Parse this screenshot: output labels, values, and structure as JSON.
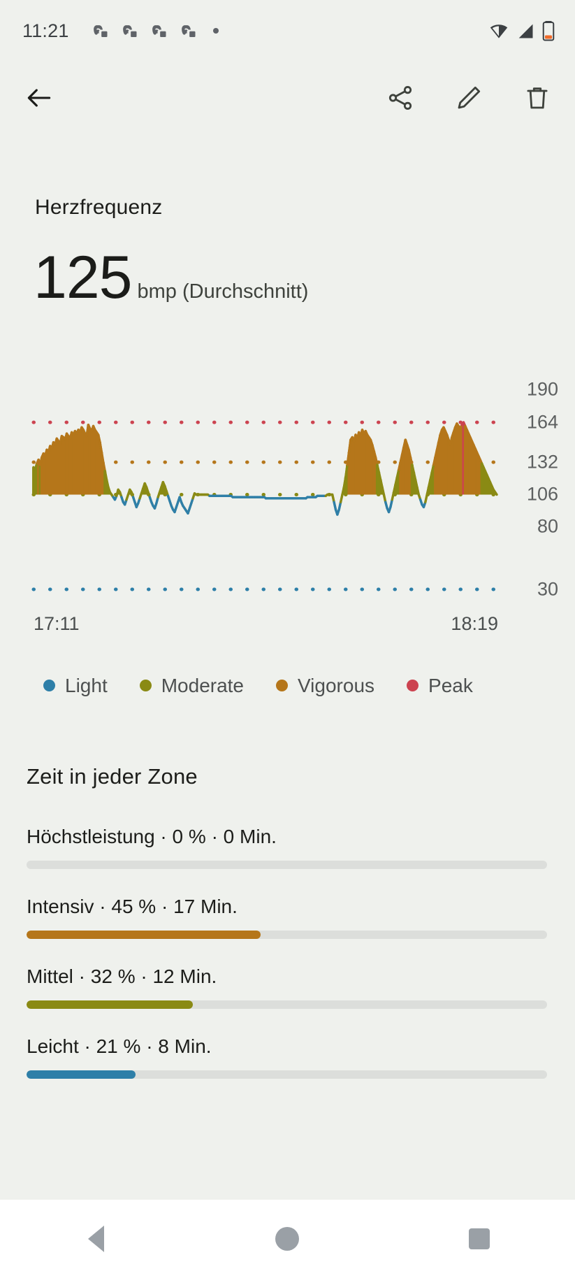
{
  "status_bar": {
    "time": "11:21",
    "notification_icons": [
      "game-controller-icon",
      "game-controller-icon",
      "game-controller-icon",
      "game-controller-icon",
      "overflow-dot-icon"
    ],
    "system_icons": [
      "wifi-icon",
      "cellular-signal-icon",
      "battery-low-icon"
    ],
    "battery_color": "#f06a2a"
  },
  "app_bar": {
    "back_label": "Zurück",
    "actions": [
      {
        "name": "share-button",
        "label": "Teilen"
      },
      {
        "name": "edit-button",
        "label": "Bearbeiten"
      },
      {
        "name": "delete-button",
        "label": "Löschen"
      }
    ]
  },
  "header": {
    "title": "Herzfrequenz",
    "value": "125",
    "unit": "bmp (Durchschnitt)"
  },
  "chart_data": {
    "type": "area",
    "title": "Herzfrequenz",
    "xlabel": "",
    "ylabel": "bpm",
    "x_tick_labels": [
      "17:11",
      "18:19"
    ],
    "x_range": [
      "17:11",
      "18:19"
    ],
    "y_tick_labels": [
      "190",
      "164",
      "132",
      "106",
      "80",
      "30"
    ],
    "y_ticks": [
      190,
      164,
      132,
      106,
      80,
      30
    ],
    "ylim": [
      30,
      205
    ],
    "grid": false,
    "zone_threshold_lines": [
      {
        "name": "Peak",
        "value": 164,
        "color": "#cc4350",
        "style": "dotted"
      },
      {
        "name": "Vigorous",
        "value": 132,
        "color": "#b5761a",
        "style": "dotted"
      },
      {
        "name": "Moderate",
        "value": 106,
        "color": "#8a8a14",
        "style": "dotted"
      },
      {
        "name": "Light",
        "value": 30,
        "color": "#2e7fa8",
        "style": "dotted"
      }
    ],
    "legend_position": "bottom",
    "legend": [
      {
        "label": "Light",
        "color": "#2e7fa8"
      },
      {
        "label": "Moderate",
        "color": "#8a8a14"
      },
      {
        "label": "Vigorous",
        "color": "#b5761a"
      },
      {
        "label": "Peak",
        "color": "#cc4350"
      }
    ],
    "series": [
      {
        "name": "Herzfrequenz",
        "note": "Per-sample heart rate over the session, colored by zone",
        "values": [
          128,
          126,
          131,
          134,
          130,
          136,
          139,
          137,
          142,
          140,
          145,
          143,
          148,
          146,
          151,
          149,
          147,
          153,
          152,
          150,
          155,
          153,
          151,
          156,
          154,
          157,
          155,
          158,
          156,
          160,
          158,
          155,
          153,
          162,
          159,
          157,
          161,
          158,
          156,
          154,
          148,
          140,
          132,
          125,
          118,
          112,
          108,
          106,
          104,
          102,
          105,
          110,
          108,
          104,
          100,
          98,
          102,
          106,
          110,
          108,
          104,
          100,
          96,
          99,
          103,
          107,
          111,
          115,
          112,
          108,
          104,
          100,
          97,
          95,
          99,
          104,
          108,
          112,
          116,
          113,
          109,
          105,
          101,
          97,
          94,
          92,
          96,
          100,
          104,
          100,
          97,
          95,
          93,
          91,
          95,
          99,
          103,
          107,
          106,
          106,
          106,
          106,
          106,
          106,
          106,
          106,
          105,
          105,
          105,
          105,
          105,
          105,
          105,
          105,
          105,
          105,
          105,
          105,
          105,
          105,
          104,
          104,
          104,
          104,
          104,
          104,
          104,
          104,
          104,
          104,
          104,
          104,
          104,
          104,
          104,
          104,
          104,
          104,
          104,
          104,
          103,
          103,
          103,
          103,
          103,
          103,
          103,
          103,
          103,
          103,
          103,
          103,
          103,
          103,
          103,
          103,
          103,
          103,
          103,
          103,
          103,
          103,
          103,
          103,
          103,
          104,
          104,
          104,
          104,
          104,
          104,
          105,
          105,
          105,
          105,
          105,
          105,
          106,
          106,
          106,
          106,
          100,
          94,
          90,
          94,
          100,
          106,
          112,
          120,
          130,
          140,
          150,
          152,
          149,
          154,
          151,
          156,
          153,
          158,
          155,
          157,
          154,
          152,
          150,
          146,
          141,
          136,
          130,
          124,
          118,
          112,
          106,
          100,
          95,
          92,
          96,
          102,
          108,
          114,
          120,
          126,
          132,
          138,
          144,
          150,
          146,
          142,
          136,
          130,
          124,
          118,
          112,
          106,
          102,
          98,
          96,
          100,
          106,
          112,
          118,
          124,
          130,
          136,
          142,
          148,
          154,
          158,
          160,
          157,
          154,
          150,
          146,
          152,
          156,
          160,
          163,
          161,
          159,
          162,
          164,
          161,
          158,
          155,
          152,
          149,
          146,
          143,
          140,
          137,
          134,
          131,
          128,
          125,
          122,
          119,
          116,
          113,
          110,
          108,
          106
        ]
      }
    ]
  },
  "zones_section": {
    "title": "Zeit in jeder Zone",
    "rows": [
      {
        "label": "Höchstleistung · 0 % · 0 Min.",
        "percent": 0,
        "color": "#cc4350",
        "name": "zone-peak"
      },
      {
        "label": "Intensiv · 45 % · 17 Min.",
        "percent": 45,
        "color": "#b5761a",
        "name": "zone-vigorous"
      },
      {
        "label": "Mittel · 32 % · 12 Min.",
        "percent": 32,
        "color": "#8a8a14",
        "name": "zone-moderate"
      },
      {
        "label": "Leicht · 21 % · 8 Min.",
        "percent": 21,
        "color": "#2e7fa8",
        "name": "zone-light"
      }
    ]
  },
  "nav_bar": {
    "back_label": "Zurück",
    "home_label": "Startbildschirm",
    "recents_label": "Übersicht"
  }
}
